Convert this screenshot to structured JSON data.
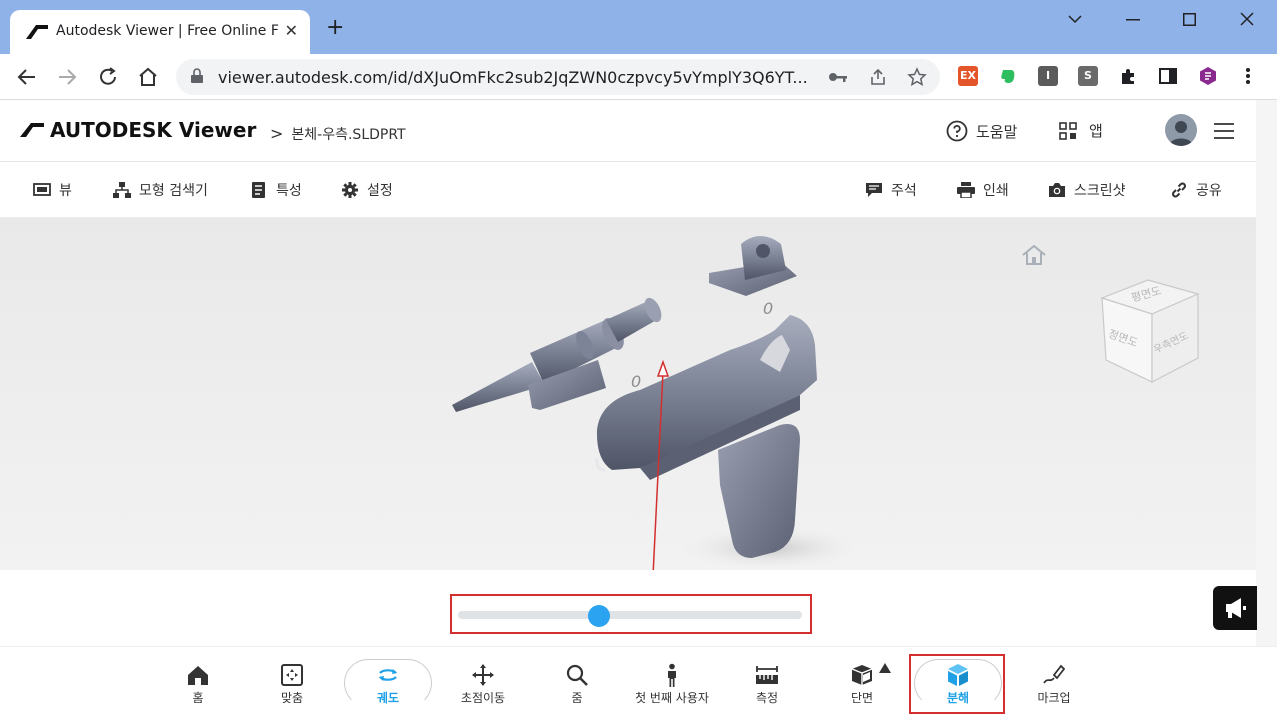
{
  "browser": {
    "tab_title": "Autodesk Viewer | Free Online F",
    "tab_close": "✕",
    "new_tab": "+",
    "url": "viewer.autodesk.com/id/dXJuOmFkc2sub2JqZWN0czpvcy5vYmplY3Q6YT...",
    "extensions": [
      "EX",
      "I",
      "S"
    ]
  },
  "app": {
    "logo_text": "AUTODESK Viewer",
    "breadcrumb_sep": ">",
    "breadcrumb_file": "본체-우측.SLDPRT",
    "help_label": "도움말",
    "apps_label": "앱"
  },
  "subtoolbar": {
    "view": "뷰",
    "model_browser": "모형 검색기",
    "properties": "특성",
    "settings": "설정",
    "comments": "주석",
    "print": "인쇄",
    "screenshot": "스크린샷",
    "share": "공유"
  },
  "viewport": {
    "viewcube_top": "평면도",
    "viewcube_front": "정면도",
    "viewcube_right": "우측면도",
    "part_label_1": "0",
    "part_label_2": "0"
  },
  "explode_slider": {
    "value": 0.41
  },
  "bottom_toolbar": {
    "home": "홈",
    "fit": "맞춤",
    "orbit": "궤도",
    "pan": "초점이동",
    "zoom": "줌",
    "first_person": "첫 번째 사용자",
    "measure": "측정",
    "section": "단면",
    "explode": "분해",
    "markup": "마크업"
  },
  "colors": {
    "accent": "#1ea1e6",
    "highlight": "#d32f2f"
  }
}
